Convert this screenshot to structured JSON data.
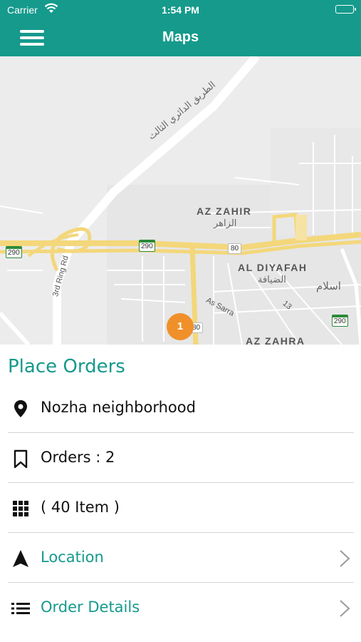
{
  "status_bar": {
    "carrier": "Carrier",
    "time": "1:54 PM",
    "battery_level": 1.0,
    "wifi_icon": "wifi-icon"
  },
  "nav": {
    "title": "Maps",
    "menu_icon": "hamburger-menu-icon"
  },
  "map": {
    "labels": {
      "az_zahir": "AZ ZAHIR",
      "az_zahir_ar": "الزاهر",
      "al_diyafah": "AL DIYAFAH",
      "al_diyafah_ar": "الضيافة",
      "az_zahra": "AZ ZAHRA",
      "islam_ar": "اسلام",
      "ring_road_ar": "الطريق الدائري الثالث",
      "ring_road": "3rd Ring Rd",
      "as_sarra": "As Sarra"
    },
    "shields": {
      "s290_left": "290",
      "s290_mid": "290",
      "s290_right": "290",
      "s80_a": "80",
      "s80_b": "80",
      "s13": "13"
    },
    "cluster_count": "1",
    "colors": {
      "major_road": "#f3d77a",
      "road": "#ffffff",
      "land": "#ececec",
      "cluster": "#f0902a"
    }
  },
  "panel": {
    "title": "Place Orders",
    "rows": [
      {
        "label": "Nozha neighborhood",
        "icon": "location-pin-icon",
        "link": false
      },
      {
        "label": "Orders : 2",
        "icon": "bookmark-icon",
        "link": false
      },
      {
        "label": "( 40 Item )",
        "icon": "grid-icon",
        "link": false
      },
      {
        "label": "Location",
        "icon": "navigation-arrow-icon",
        "link": true
      },
      {
        "label": "Order Details",
        "icon": "list-icon",
        "link": true
      }
    ]
  },
  "colors": {
    "accent": "#159a8c",
    "divider": "#d5d5d5",
    "chevron": "#9a9a9a"
  }
}
